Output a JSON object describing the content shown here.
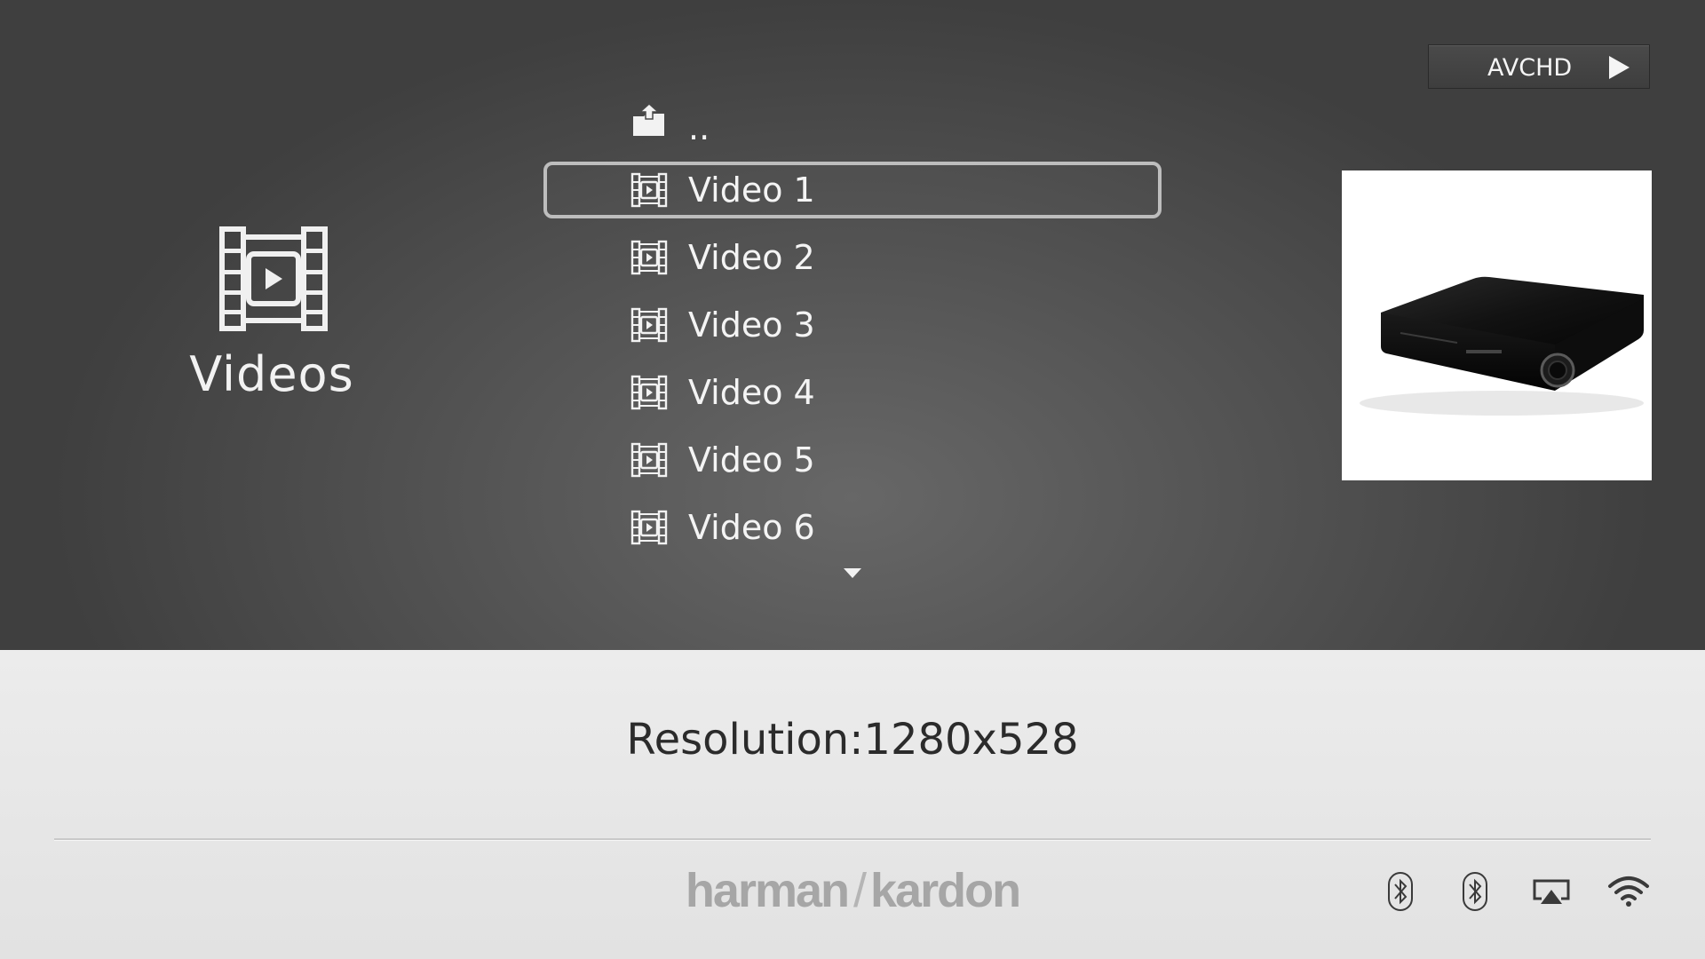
{
  "category": {
    "label": "Videos",
    "icon": "film-play-icon"
  },
  "file_list": {
    "parent_label": "..",
    "parent_icon": "folder-up-icon",
    "items": [
      {
        "label": "Video 1",
        "icon": "film-icon",
        "selected": true
      },
      {
        "label": "Video 2",
        "icon": "film-icon"
      },
      {
        "label": "Video 3",
        "icon": "film-icon"
      },
      {
        "label": "Video 4",
        "icon": "film-icon"
      },
      {
        "label": "Video 5",
        "icon": "film-icon"
      },
      {
        "label": "Video 6",
        "icon": "film-icon"
      }
    ],
    "scroll_icon": "chevron-down-icon"
  },
  "format_button": {
    "label": "AVCHD",
    "icon": "play-icon"
  },
  "preview": {
    "alt": "product-thumbnail"
  },
  "info": {
    "resolution": "Resolution:1280x528"
  },
  "brand": {
    "left": "harman",
    "right": "kardon"
  },
  "status_icons": [
    "bluetooth-icon",
    "bluetooth-icon",
    "airplay-icon",
    "wifi-icon"
  ],
  "colors": {
    "selection_border": "#bdbdbd",
    "list_text": "#f4f4f4",
    "brand_text": "#a6a6a6"
  }
}
